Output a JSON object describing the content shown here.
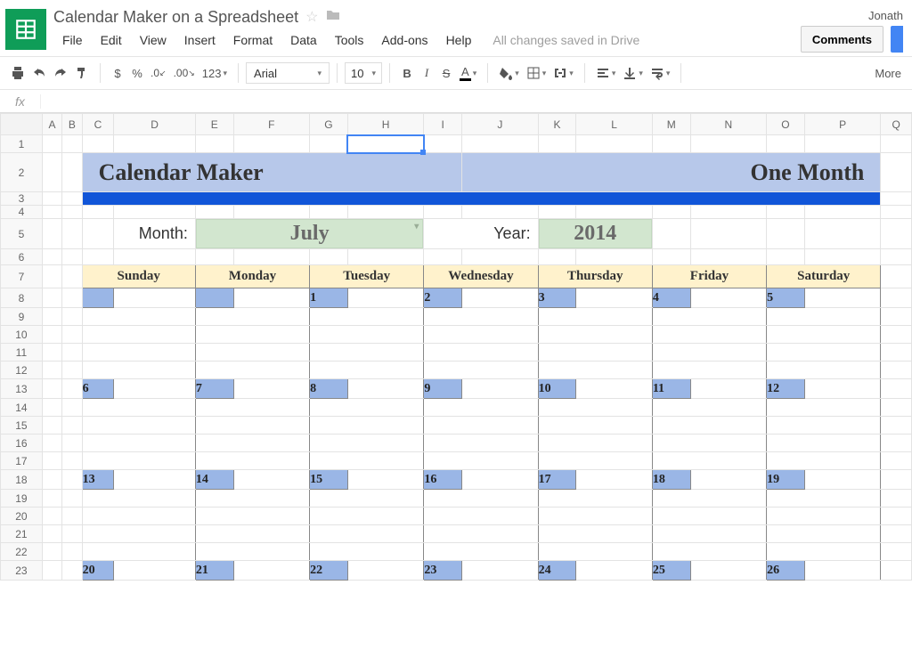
{
  "doc": {
    "title": "Calendar Maker on a Spreadsheet",
    "user": "Jonath"
  },
  "menu": {
    "file": "File",
    "edit": "Edit",
    "view": "View",
    "insert": "Insert",
    "format": "Format",
    "data": "Data",
    "tools": "Tools",
    "addons": "Add-ons",
    "help": "Help",
    "saved": "All changes saved in Drive"
  },
  "buttons": {
    "comments": "Comments",
    "more": "More"
  },
  "toolbar": {
    "currency": "$",
    "percent": "%",
    "dec_dec": ".0←",
    "inc_dec": ".00→",
    "numfmt": "123",
    "font": "Arial",
    "size": "10",
    "bold": "B",
    "italic": "I",
    "strike": "S",
    "underline_a": "A"
  },
  "fx": {
    "label": "fx"
  },
  "cols": [
    "A",
    "B",
    "C",
    "D",
    "E",
    "F",
    "G",
    "H",
    "I",
    "J",
    "K",
    "L",
    "M",
    "N",
    "O",
    "P",
    "Q"
  ],
  "rows": [
    "1",
    "2",
    "3",
    "4",
    "5",
    "6",
    "7",
    "8",
    "9",
    "10",
    "11",
    "12",
    "13",
    "14",
    "15",
    "16",
    "17",
    "18",
    "19",
    "20",
    "21",
    "22",
    "23"
  ],
  "calendar": {
    "title_left": "Calendar Maker",
    "title_right": "One Month",
    "month_label": "Month:",
    "month_value": "July",
    "year_label": "Year:",
    "year_value": "2014",
    "days": [
      "Sunday",
      "Monday",
      "Tuesday",
      "Wednesday",
      "Thursday",
      "Friday",
      "Saturday"
    ],
    "weeks": [
      [
        "",
        "",
        "1",
        "2",
        "3",
        "4",
        "5"
      ],
      [
        "6",
        "7",
        "8",
        "9",
        "10",
        "11",
        "12"
      ],
      [
        "13",
        "14",
        "15",
        "16",
        "17",
        "18",
        "19"
      ],
      [
        "20",
        "21",
        "22",
        "23",
        "24",
        "25",
        "26"
      ]
    ]
  }
}
